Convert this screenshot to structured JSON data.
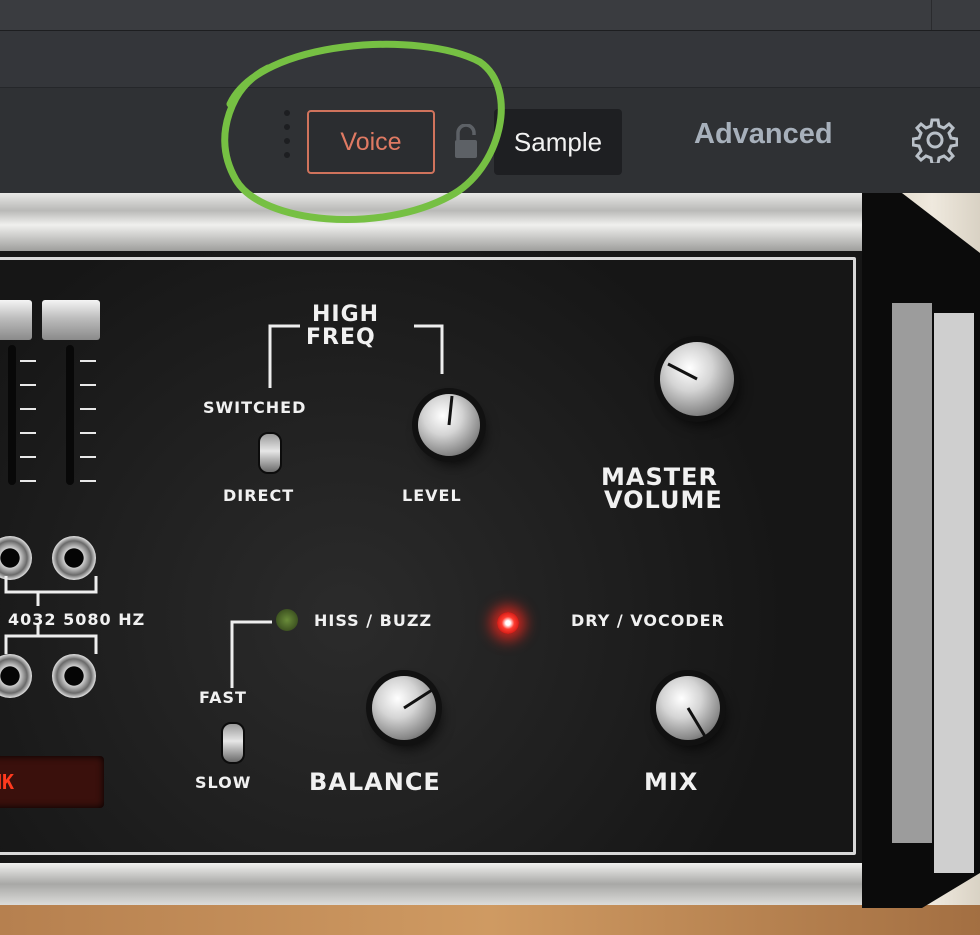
{
  "toolbar": {
    "voice_label": "Voice",
    "sample_label": "Sample",
    "advanced_label": "Advanced"
  },
  "panel": {
    "high_freq_line1": "HIGH",
    "high_freq_line2": "FREQ",
    "switched": "SWITCHED",
    "direct": "DIRECT",
    "level": "LEVEL",
    "master_line1": "MASTER",
    "master_line2": "VOLUME",
    "freq_labels": "4032 5080 HZ",
    "hiss_buzz": "HISS / BUZZ",
    "dry_vocoder": "DRY / VOCODER",
    "fast": "FAST",
    "slow": "SLOW",
    "balance": "BALANCE",
    "mix": "MIX",
    "display_text": "NK"
  },
  "colors": {
    "accent": "#e07a63",
    "annotation": "#76c043",
    "led_red": "#ff3b2f"
  }
}
